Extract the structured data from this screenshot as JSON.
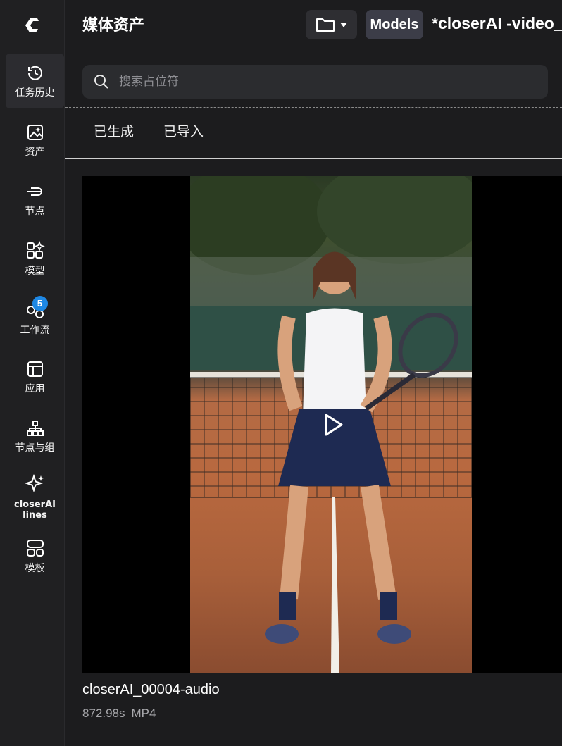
{
  "sidebar": {
    "items": [
      {
        "label": "任务历史",
        "icon": "history-icon",
        "active": true
      },
      {
        "label": "资产",
        "icon": "image-asset-icon"
      },
      {
        "label": "节点",
        "icon": "node-plug-icon"
      },
      {
        "label": "模型",
        "icon": "model-grid-icon"
      },
      {
        "label": "工作流",
        "icon": "workflow-icon",
        "badge": "5"
      },
      {
        "label": "应用",
        "icon": "app-layout-icon"
      },
      {
        "label": "节点与组",
        "icon": "node-group-icon"
      },
      {
        "label": "closerAI lines",
        "icon": "sparkle-icon"
      },
      {
        "label": "模板",
        "icon": "template-icon"
      }
    ]
  },
  "panel": {
    "title": "媒体资产",
    "models_label": "Models",
    "workflow_tab": "*closerAI -video_",
    "search_placeholder": "搜索占位符",
    "tabs": [
      "已生成",
      "已导入"
    ]
  },
  "asset": {
    "name": "closerAI_00004-audio",
    "duration": "872.98s",
    "format": "MP4"
  },
  "colors": {
    "badge": "#1e88e5",
    "background": "#1c1c1e",
    "rail": "#202022"
  }
}
